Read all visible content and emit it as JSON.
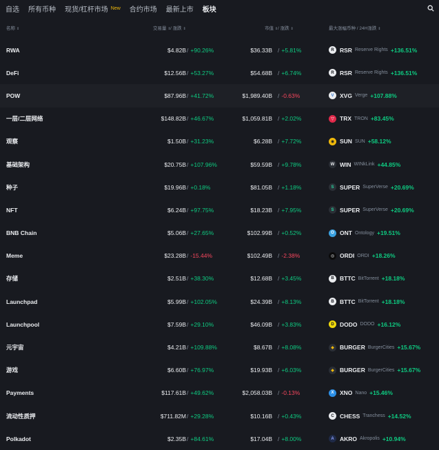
{
  "nav": {
    "tabs": [
      {
        "label": "自选"
      },
      {
        "label": "所有币种"
      },
      {
        "label": "现货/杠杆市场",
        "badge": "New"
      },
      {
        "label": "合约市场"
      },
      {
        "label": "最新上市"
      },
      {
        "label": "板块",
        "active": true
      }
    ]
  },
  "header": {
    "name": "名称",
    "volume": "交易量",
    "volume_change": "/ 涨跌",
    "mcap": "市值",
    "mcap_change": "/ 涨跌",
    "top_coin": "最大涨幅币种 / 24H涨跌"
  },
  "colors": {
    "up": "#0ecb81",
    "down": "#f6465d",
    "accent": "#f0b90b"
  },
  "rows": [
    {
      "name": "RWA",
      "volume": "$4.82B",
      "vol_change": "+90.26%",
      "mcap": "$36.33B",
      "mcap_change": "+5.81%",
      "coin_symbol": "RSR",
      "coin_name": "Reserve Rights",
      "coin_change": "+136.51%",
      "icon": "rsr-icon"
    },
    {
      "name": "DeFi",
      "volume": "$12.56B",
      "vol_change": "+53.27%",
      "mcap": "$54.68B",
      "mcap_change": "+6.74%",
      "coin_symbol": "RSR",
      "coin_name": "Reserve Rights",
      "coin_change": "+136.51%",
      "icon": "rsr-icon"
    },
    {
      "name": "POW",
      "volume": "$87.96B",
      "vol_change": "+41.72%",
      "mcap": "$1,989.40B",
      "mcap_change": "-0.63%",
      "coin_symbol": "XVG",
      "coin_name": "Verge",
      "coin_change": "+107.88%",
      "icon": "xvg-icon"
    },
    {
      "name": "一层/二层网络",
      "volume": "$148.82B",
      "vol_change": "+46.67%",
      "mcap": "$1,059.81B",
      "mcap_change": "+2.02%",
      "coin_symbol": "TRX",
      "coin_name": "TRON",
      "coin_change": "+83.45%",
      "icon": "trx-icon"
    },
    {
      "name": "观察",
      "volume": "$1.50B",
      "vol_change": "+31.23%",
      "mcap": "$6.28B",
      "mcap_change": "+7.72%",
      "coin_symbol": "SUN",
      "coin_name": "SUN",
      "coin_change": "+58.12%",
      "icon": "sun-icon"
    },
    {
      "name": "基础架构",
      "volume": "$20.75B",
      "vol_change": "+107.96%",
      "mcap": "$59.59B",
      "mcap_change": "+9.78%",
      "coin_symbol": "WIN",
      "coin_name": "WINkLink",
      "coin_change": "+44.85%",
      "icon": "win-icon"
    },
    {
      "name": "种子",
      "volume": "$19.96B",
      "vol_change": "+0.18%",
      "mcap": "$81.05B",
      "mcap_change": "+1.18%",
      "coin_symbol": "SUPER",
      "coin_name": "SuperVerse",
      "coin_change": "+20.69%",
      "icon": "super-icon"
    },
    {
      "name": "NFT",
      "volume": "$6.24B",
      "vol_change": "+97.75%",
      "mcap": "$18.23B",
      "mcap_change": "+7.95%",
      "coin_symbol": "SUPER",
      "coin_name": "SuperVerse",
      "coin_change": "+20.69%",
      "icon": "super-icon"
    },
    {
      "name": "BNB Chain",
      "volume": "$5.06B",
      "vol_change": "+27.65%",
      "mcap": "$102.99B",
      "mcap_change": "+0.52%",
      "coin_symbol": "ONT",
      "coin_name": "Ontology",
      "coin_change": "+19.51%",
      "icon": "ont-icon"
    },
    {
      "name": "Meme",
      "volume": "$23.28B",
      "vol_change": "-15.44%",
      "mcap": "$102.49B",
      "mcap_change": "-2.38%",
      "coin_symbol": "ORDI",
      "coin_name": "ORDI",
      "coin_change": "+18.26%",
      "icon": "ordi-icon"
    },
    {
      "name": "存储",
      "volume": "$2.51B",
      "vol_change": "+38.30%",
      "mcap": "$12.68B",
      "mcap_change": "+3.45%",
      "coin_symbol": "BTTC",
      "coin_name": "BitTorrent",
      "coin_change": "+18.18%",
      "icon": "bttc-icon"
    },
    {
      "name": "Launchpad",
      "volume": "$5.99B",
      "vol_change": "+102.05%",
      "mcap": "$24.39B",
      "mcap_change": "+8.13%",
      "coin_symbol": "BTTC",
      "coin_name": "BitTorrent",
      "coin_change": "+18.18%",
      "icon": "bttc-icon"
    },
    {
      "name": "Launchpool",
      "volume": "$7.59B",
      "vol_change": "+29.10%",
      "mcap": "$46.09B",
      "mcap_change": "+3.83%",
      "coin_symbol": "DODO",
      "coin_name": "DODO",
      "coin_change": "+16.12%",
      "icon": "dodo-icon"
    },
    {
      "name": "元宇宙",
      "volume": "$4.21B",
      "vol_change": "+109.88%",
      "mcap": "$8.67B",
      "mcap_change": "+8.08%",
      "coin_symbol": "BURGER",
      "coin_name": "BurgerCities",
      "coin_change": "+15.67%",
      "icon": "burger-icon"
    },
    {
      "name": "游戏",
      "volume": "$6.60B",
      "vol_change": "+76.97%",
      "mcap": "$19.93B",
      "mcap_change": "+6.03%",
      "coin_symbol": "BURGER",
      "coin_name": "BurgerCities",
      "coin_change": "+15.67%",
      "icon": "burger-icon"
    },
    {
      "name": "Payments",
      "volume": "$117.61B",
      "vol_change": "+49.62%",
      "mcap": "$2,058.03B",
      "mcap_change": "-0.13%",
      "coin_symbol": "XNO",
      "coin_name": "Nano",
      "coin_change": "+15.46%",
      "icon": "xno-icon"
    },
    {
      "name": "流动性质押",
      "volume": "$711.82M",
      "vol_change": "+29.28%",
      "mcap": "$10.16B",
      "mcap_change": "+0.43%",
      "coin_symbol": "CHESS",
      "coin_name": "Tranchess",
      "coin_change": "+14.52%",
      "icon": "chess-icon"
    },
    {
      "name": "Polkadot",
      "volume": "$2.35B",
      "vol_change": "+84.61%",
      "mcap": "$17.04B",
      "mcap_change": "+8.00%",
      "coin_symbol": "AKRO",
      "coin_name": "Akropolis",
      "coin_change": "+10.94%",
      "icon": "akro-icon"
    }
  ]
}
